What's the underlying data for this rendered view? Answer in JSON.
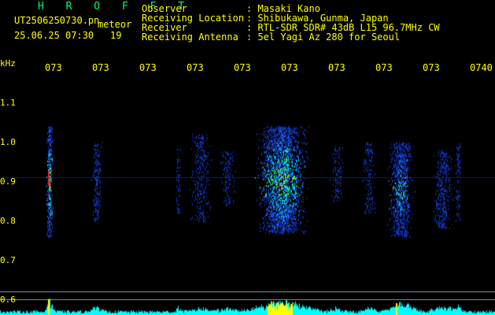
{
  "header": {
    "brand": "H R O F F T",
    "file_name": "UT2506250730.pn",
    "mode": "meteor",
    "timestamp": "25.06.25 07:30",
    "count": "19"
  },
  "metadata": [
    {
      "key": "Observer",
      "value": ": Masaki Kano"
    },
    {
      "key": "Receiving Location",
      "value": ": Shibukawa, Gunma, Japan"
    },
    {
      "key": "Receiver",
      "value": ": RTL-SDR SDR# 43dB L15 96.7MHz CW"
    },
    {
      "key": "Receiving Antenna",
      "value": ": 5el Yagi Az 280 for Seoul"
    }
  ],
  "axis": {
    "unit": "kHz",
    "time_ticks": [
      "073",
      "073",
      "073",
      "073",
      "073",
      "073",
      "073",
      "073",
      "073",
      "0740"
    ],
    "freq_ticks": [
      "1.1",
      "1.0",
      "0.9",
      "0.8",
      "0.7",
      "0.6"
    ]
  },
  "colors": {
    "label": "#ffff00",
    "brand": "#00ff66",
    "background": "#000000",
    "trace": "#00ffff",
    "baseline": "#0a1a6a"
  },
  "spectrogram": {
    "freq_range_khz": [
      0.6,
      1.1
    ],
    "carrier_khz": 0.91,
    "bursts": [
      {
        "center": 0.1,
        "width": 0.008,
        "intensity": 0.95,
        "fmin": 0.76,
        "fmax": 1.04
      },
      {
        "center": 0.195,
        "width": 0.012,
        "intensity": 0.5,
        "fmin": 0.8,
        "fmax": 1.0
      },
      {
        "center": 0.36,
        "width": 0.006,
        "intensity": 0.4,
        "fmin": 0.82,
        "fmax": 0.99
      },
      {
        "center": 0.405,
        "width": 0.025,
        "intensity": 0.35,
        "fmin": 0.8,
        "fmax": 1.02
      },
      {
        "center": 0.46,
        "width": 0.02,
        "intensity": 0.3,
        "fmin": 0.84,
        "fmax": 0.98
      },
      {
        "center": 0.57,
        "width": 0.06,
        "intensity": 0.95,
        "fmin": 0.77,
        "fmax": 1.04
      },
      {
        "center": 0.68,
        "width": 0.015,
        "intensity": 0.35,
        "fmin": 0.85,
        "fmax": 0.99
      },
      {
        "center": 0.745,
        "width": 0.015,
        "intensity": 0.35,
        "fmin": 0.82,
        "fmax": 1.0
      },
      {
        "center": 0.81,
        "width": 0.03,
        "intensity": 0.75,
        "fmin": 0.76,
        "fmax": 1.0
      },
      {
        "center": 0.895,
        "width": 0.025,
        "intensity": 0.45,
        "fmin": 0.78,
        "fmax": 0.98
      },
      {
        "center": 0.925,
        "width": 0.008,
        "intensity": 0.4,
        "fmin": 0.8,
        "fmax": 1.0
      }
    ]
  }
}
